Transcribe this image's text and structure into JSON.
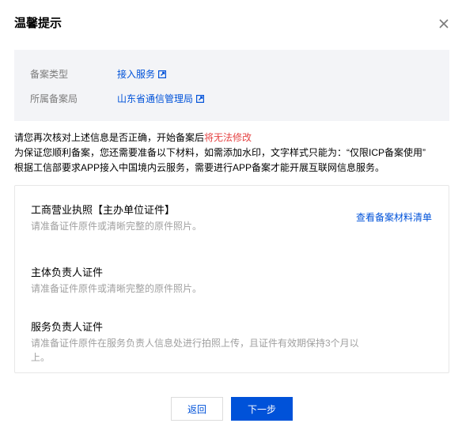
{
  "dialog": {
    "title": "温馨提示"
  },
  "info": {
    "rows": [
      {
        "label": "备案类型",
        "value": "接入服务"
      },
      {
        "label": "所属备案局",
        "value": "山东省通信管理局"
      }
    ]
  },
  "notes": {
    "line1_prefix": "请您再次核对上述信息是否正确，开始备案后",
    "line1_warning": "将无法修改",
    "line2": "为保证您顺利备案，您还需要准备以下材料，如需添加水印，文字样式只能为：“仅限ICP备案使用”",
    "line3": "根据工信部要求APP接入中国境内云服务，需要进行APP备案才能开展互联网信息服务。"
  },
  "materials": {
    "view_list_link": "查看备案材料清单",
    "items": [
      {
        "name": "工商营业执照【主办单位证件】",
        "desc": "请准备证件原件或清晰完整的原件照片。"
      },
      {
        "name": "主体负责人证件",
        "desc": "请准备证件原件或清晰完整的原件照片。"
      },
      {
        "name": "服务负责人证件",
        "desc": "请准备证件原件在服务负责人信息处进行拍照上传，且证件有效期保持3个月以上。"
      }
    ]
  },
  "buttons": {
    "back": "返回",
    "next": "下一步"
  },
  "colors": {
    "link": "#0052d9",
    "warning": "#e54545",
    "info_bg": "#f3f4f7"
  }
}
